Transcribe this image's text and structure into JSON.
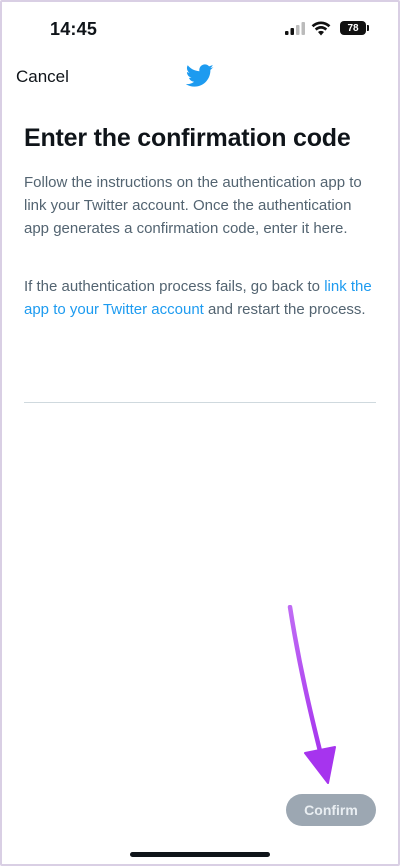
{
  "status_bar": {
    "time": "14:45",
    "battery_level": "78",
    "icons": [
      "signal-icon",
      "wifi-icon",
      "battery-icon"
    ]
  },
  "nav": {
    "cancel_label": "Cancel",
    "logo_icon": "twitter-bird-icon"
  },
  "main": {
    "title": "Enter the confirmation code",
    "paragraph1": "Follow the instructions on the authentication app to link your Twitter account. Once the authentication app generates a confirmation code, enter it here.",
    "paragraph2_before": "If the authentication process fails, go back to ",
    "paragraph2_link": "link the app to your Twitter account",
    "paragraph2_after": " and restart the process.",
    "code_input_value": "",
    "code_input_placeholder": ""
  },
  "footer": {
    "confirm_label": "Confirm"
  },
  "annotation": {
    "arrow_icon": "purple-arrow-annotation",
    "arrow_color": "#b347f2"
  },
  "colors": {
    "brand": "#1d9bf0",
    "text_primary": "#0f1419",
    "text_secondary": "#536471",
    "button_disabled": "#8b98a5"
  }
}
